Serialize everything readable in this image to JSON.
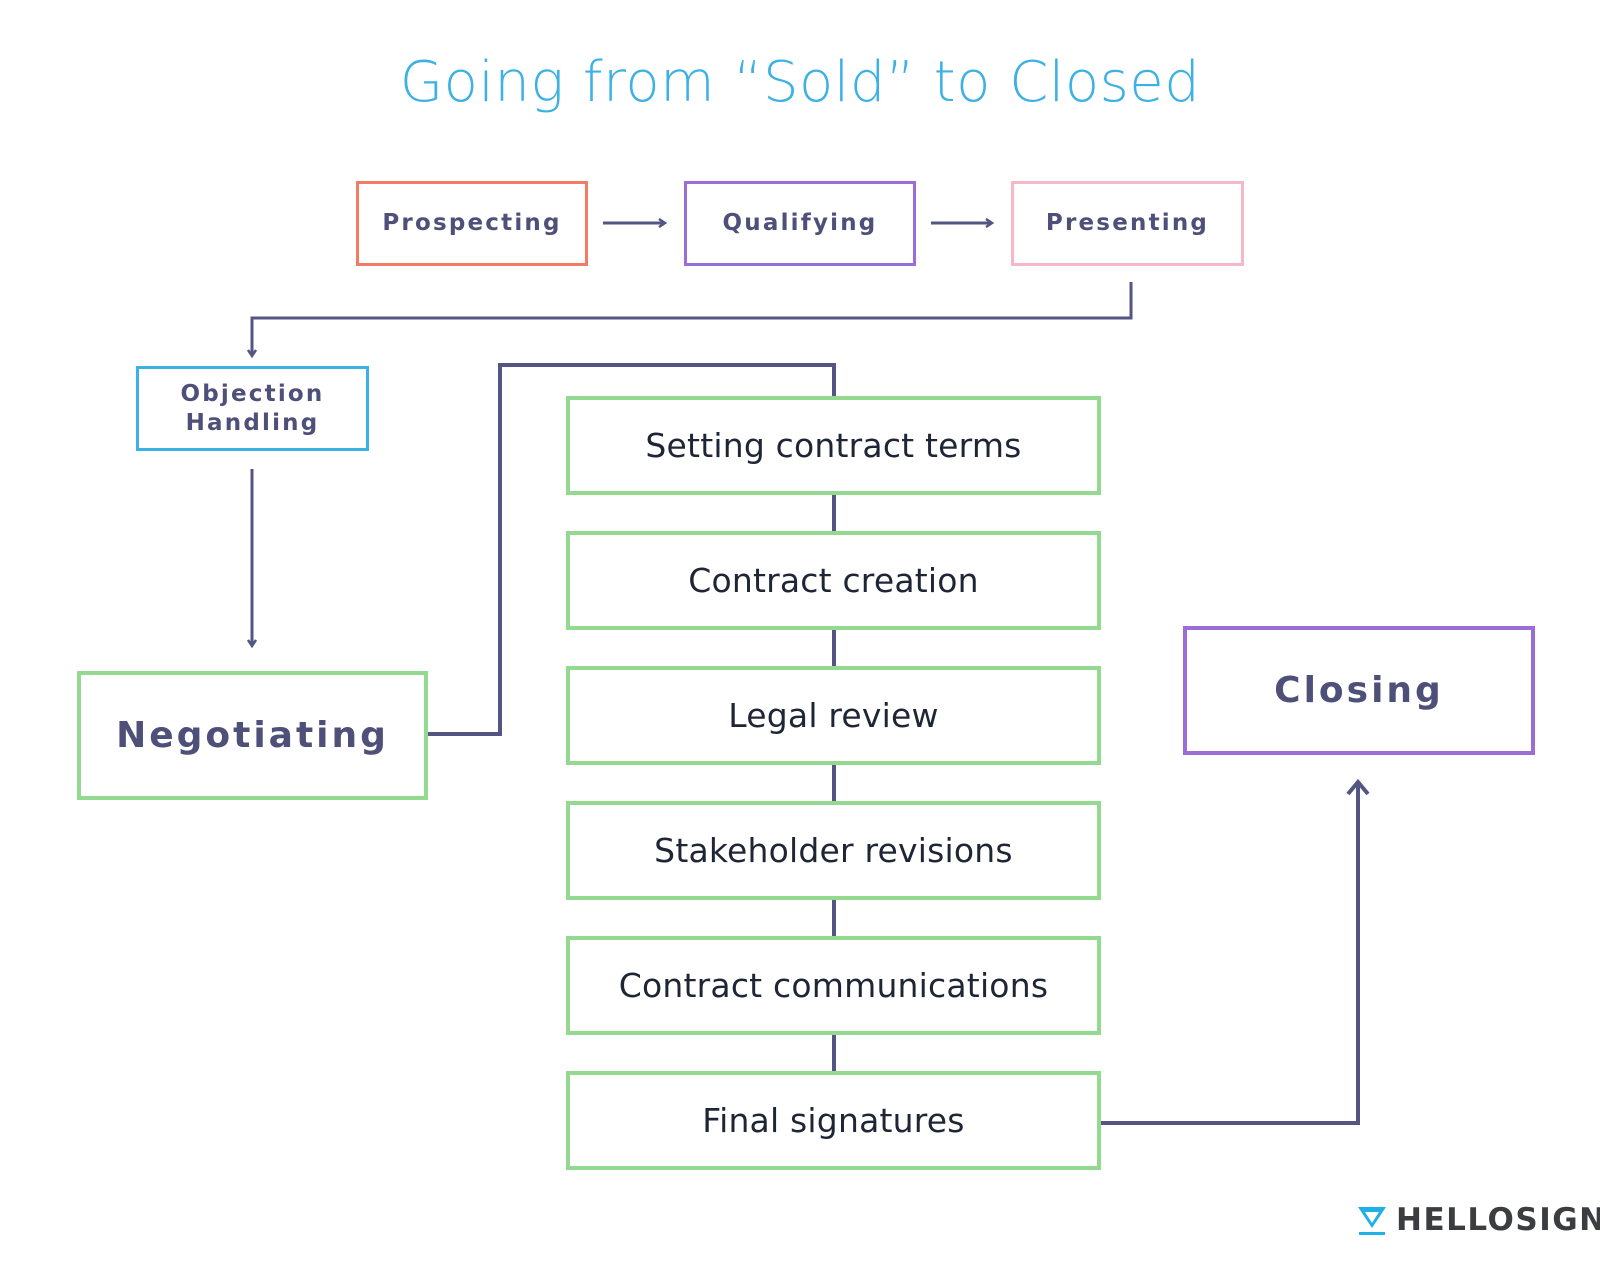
{
  "title": "Going from “Sold” to Closed",
  "stages": {
    "prospecting": {
      "label": "Prospecting",
      "color": "#f27c63"
    },
    "qualifying": {
      "label": "Qualifying",
      "color": "#9a6ed6"
    },
    "presenting": {
      "label": "Presenting",
      "color": "#f6b7c9"
    },
    "objection_handling": {
      "label": "Objection\nHandling",
      "color": "#3cb1e4"
    },
    "negotiating": {
      "label": "Negotiating",
      "color": "#93d98f"
    },
    "closing": {
      "label": "Closing",
      "color": "#9a6ed6"
    }
  },
  "contract_steps": [
    "Setting contract terms",
    "Contract creation",
    "Legal review",
    "Stakeholder revisions",
    "Contract communications",
    "Final signatures"
  ],
  "connector_color": "#535682",
  "brand": {
    "name": "HELLOSIGN",
    "icon": "hellosign-logo-icon",
    "icon_color": "#1fb0e6"
  }
}
